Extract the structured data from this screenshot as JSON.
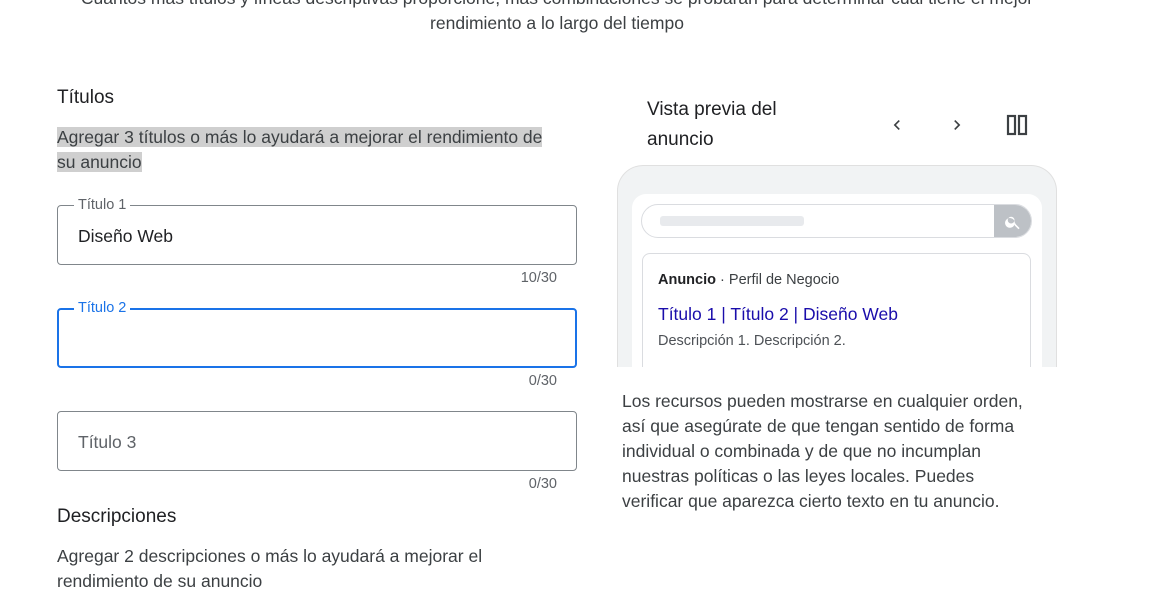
{
  "intro": {
    "line1": "Cuantos más títulos y líneas descriptivas proporcione, más combinaciones se probarán para determinar cuál tiene el mejor",
    "line2": "rendimiento a lo largo del tiempo"
  },
  "headlines": {
    "title": "Títulos",
    "helper_line1": "Agregar 3 títulos o más lo ayudará a mejorar el rendimiento de",
    "helper_line2": "su anuncio",
    "fields": [
      {
        "label": "Título 1",
        "value": "Diseño Web",
        "counter": "10/30"
      },
      {
        "label": "Título 2",
        "value": "",
        "counter": "0/30",
        "focused": true
      },
      {
        "label": "",
        "placeholder": "Título 3",
        "value": "",
        "counter": "0/30"
      }
    ]
  },
  "descriptions": {
    "title": "Descripciones",
    "helper_line1": "Agregar 2 descripciones o más lo ayudará a mejorar el",
    "helper_line2": "rendimiento de su anuncio"
  },
  "preview": {
    "title_line1": "Vista previa del",
    "title_line2": "anuncio",
    "icons": {
      "prev": "chevron-left-icon",
      "next": "chevron-right-icon",
      "layout": "split-view-icon",
      "search": "search-icon"
    },
    "ad": {
      "badge": "Anuncio",
      "separator": "·",
      "business": "Perfil de Negocio",
      "headline": "Título 1 | Título 2 | Diseño Web",
      "description": "Descripción 1. Descripción 2."
    }
  },
  "disclaimer": [
    "Los recursos pueden mostrarse en cualquier orden,",
    "así que asegúrate de que tengan sentido de forma",
    "individual o combinada y de que no incumplan",
    "nuestras políticas o las leyes locales. Puedes",
    "verificar que aparezca cierto texto en tu anuncio."
  ],
  "colors": {
    "focus": "#1a73e8",
    "ad_link": "#1a0dab",
    "highlight": "#cfcfcf"
  }
}
